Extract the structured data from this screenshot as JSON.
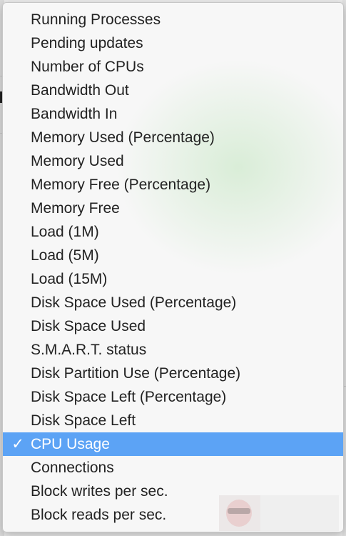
{
  "menu": {
    "items": [
      {
        "label": "Running Processes",
        "selected": false
      },
      {
        "label": "Pending updates",
        "selected": false
      },
      {
        "label": "Number of CPUs",
        "selected": false
      },
      {
        "label": "Bandwidth Out",
        "selected": false
      },
      {
        "label": "Bandwidth In",
        "selected": false
      },
      {
        "label": "Memory Used (Percentage)",
        "selected": false
      },
      {
        "label": "Memory Used",
        "selected": false
      },
      {
        "label": "Memory Free (Percentage)",
        "selected": false
      },
      {
        "label": "Memory Free",
        "selected": false
      },
      {
        "label": "Load (1M)",
        "selected": false
      },
      {
        "label": "Load (5M)",
        "selected": false
      },
      {
        "label": "Load (15M)",
        "selected": false
      },
      {
        "label": "Disk Space Used (Percentage)",
        "selected": false
      },
      {
        "label": "Disk Space Used",
        "selected": false
      },
      {
        "label": "S.M.A.R.T. status",
        "selected": false
      },
      {
        "label": "Disk Partition Use (Percentage)",
        "selected": false
      },
      {
        "label": "Disk Space Left (Percentage)",
        "selected": false
      },
      {
        "label": "Disk Space Left",
        "selected": false
      },
      {
        "label": "CPU Usage",
        "selected": true
      },
      {
        "label": "Connections",
        "selected": false
      },
      {
        "label": "Block writes per sec.",
        "selected": false
      },
      {
        "label": "Block reads per sec.",
        "selected": false
      }
    ],
    "checkmark": "✓",
    "selection_color": "#5ca3f5"
  },
  "icons": {
    "checkmark": "checkmark-icon",
    "avatar": "avatar-icon"
  }
}
